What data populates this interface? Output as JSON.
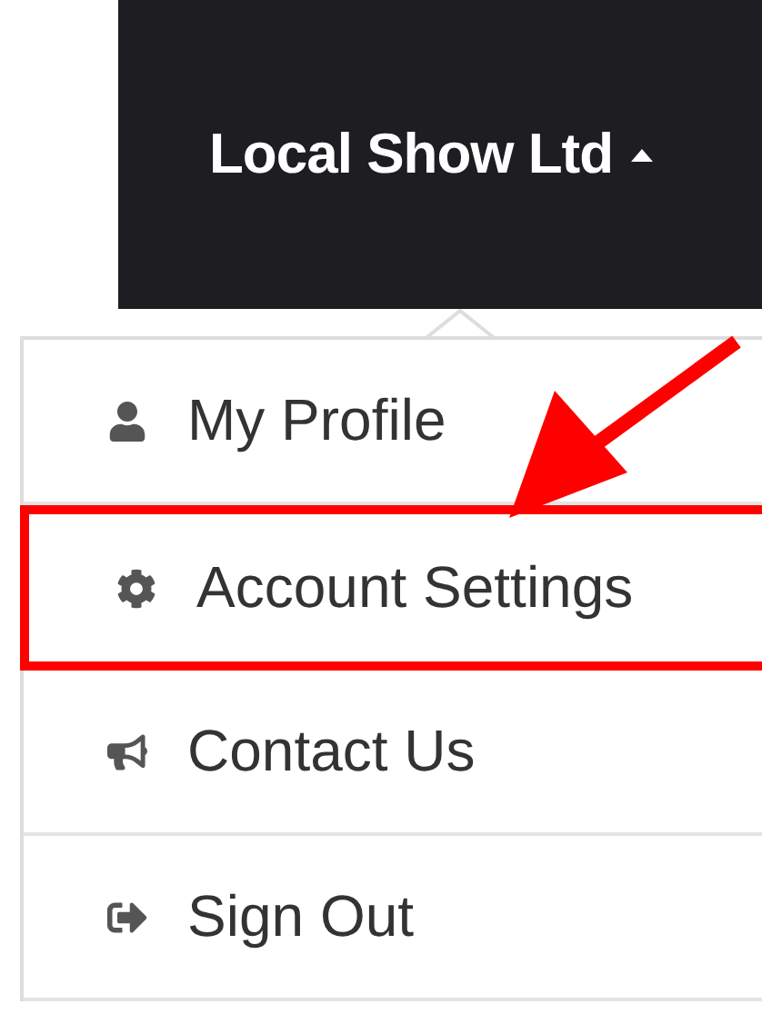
{
  "navbar": {
    "account_name": "Local Show Ltd",
    "menu_open": true
  },
  "menu": {
    "items": [
      {
        "label": "My Profile",
        "highlighted": false
      },
      {
        "label": "Account Settings",
        "highlighted": true
      },
      {
        "label": "Contact Us",
        "highlighted": false
      },
      {
        "label": "Sign Out",
        "highlighted": false
      }
    ]
  }
}
